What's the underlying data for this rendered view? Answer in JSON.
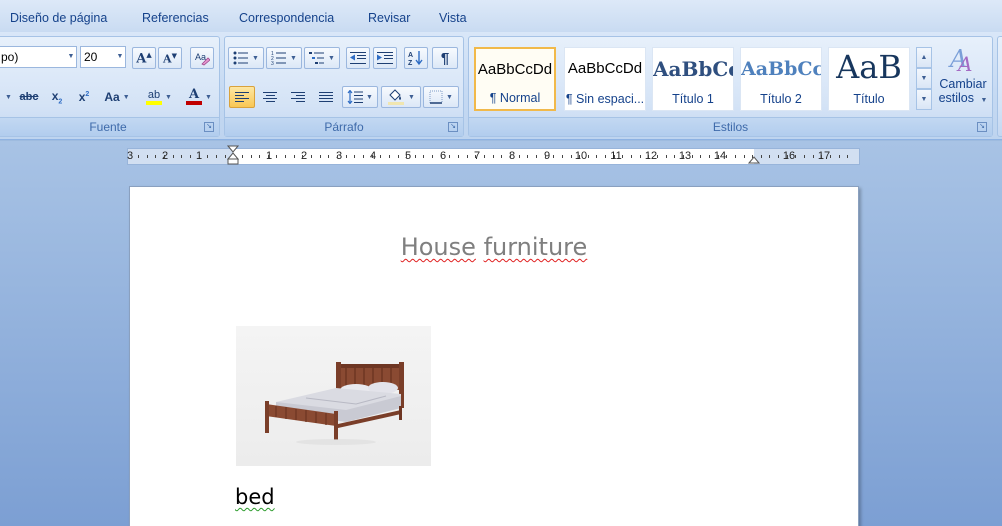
{
  "tabs": [
    "Diseño de página",
    "Referencias",
    "Correspondencia",
    "Revisar",
    "Vista"
  ],
  "font_group": {
    "label": "Fuente",
    "font_name": "po)",
    "font_size": "20",
    "strike_label": "abc",
    "case_label": "Aa",
    "highlight_label": "ab"
  },
  "paragraph_group": {
    "label": "Párrafo"
  },
  "styles_group": {
    "label": "Estilos",
    "tiles": [
      {
        "sample": "AaBbCcDd",
        "name": "¶ Normal"
      },
      {
        "sample": "AaBbCcDd",
        "name": "¶ Sin espaci..."
      },
      {
        "sample": "AaBbCc",
        "name": "Título 1"
      },
      {
        "sample": "AaBbCc",
        "name": "Título 2"
      },
      {
        "sample": "AaB",
        "name": "Título"
      }
    ],
    "change_styles_line1": "Cambiar",
    "change_styles_line2": "estilos"
  },
  "ruler": {
    "labels": [
      "3",
      "2",
      "1",
      "1",
      "2",
      "3",
      "4",
      "5",
      "6",
      "7",
      "8",
      "9",
      "10",
      "11",
      "12",
      "13",
      "14",
      "16",
      "17"
    ]
  },
  "document": {
    "title_word1": "House",
    "title_word2": "furniture",
    "caption": "bed"
  },
  "colors": {
    "highlight": "#ffff00",
    "font_color": "#c00000",
    "selected_style_border": "#f1b94a"
  }
}
